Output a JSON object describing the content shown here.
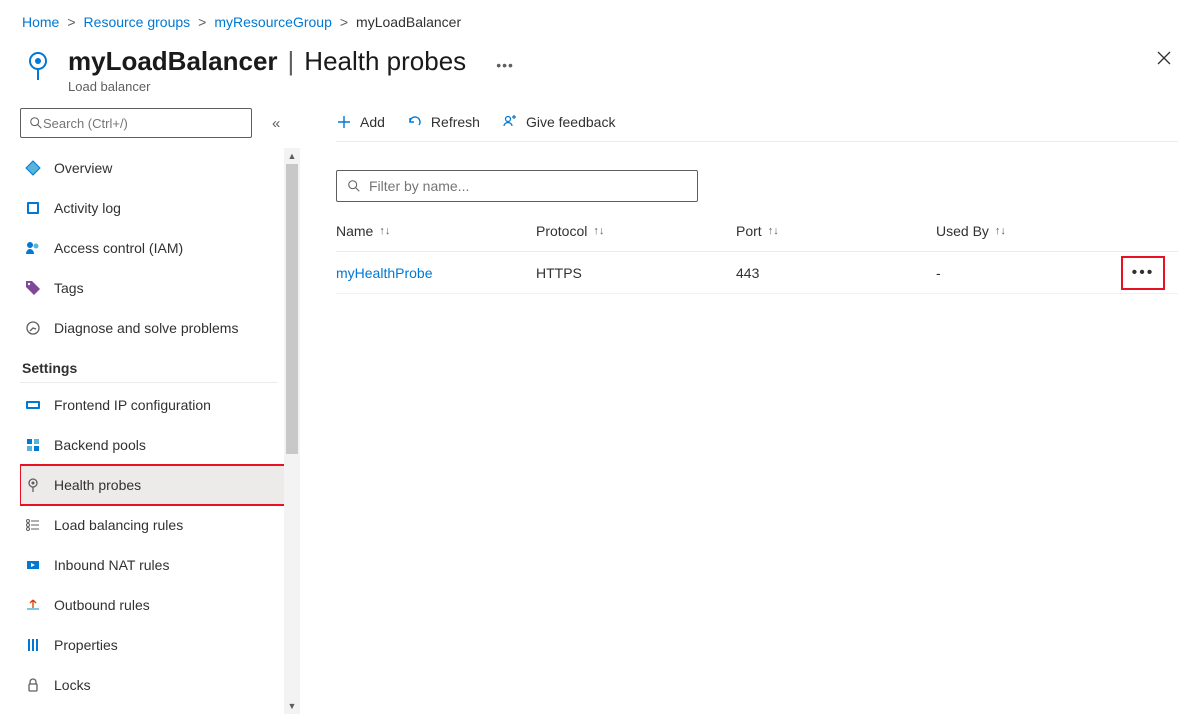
{
  "breadcrumb": [
    {
      "label": "Home",
      "link": true
    },
    {
      "label": "Resource groups",
      "link": true
    },
    {
      "label": "myResourceGroup",
      "link": true
    },
    {
      "label": "myLoadBalancer",
      "link": false
    }
  ],
  "header": {
    "title_main": "myLoadBalancer",
    "title_section": "Health probes",
    "subtitle": "Load balancer"
  },
  "sidebar": {
    "search_placeholder": "Search (Ctrl+/)",
    "top_items": [
      {
        "label": "Overview",
        "icon": "overview-icon"
      },
      {
        "label": "Activity log",
        "icon": "activity-log-icon"
      },
      {
        "label": "Access control (IAM)",
        "icon": "access-control-icon"
      },
      {
        "label": "Tags",
        "icon": "tags-icon"
      },
      {
        "label": "Diagnose and solve problems",
        "icon": "diagnose-icon"
      }
    ],
    "settings_label": "Settings",
    "settings_items": [
      {
        "label": "Frontend IP configuration",
        "icon": "frontend-ip-icon"
      },
      {
        "label": "Backend pools",
        "icon": "backend-pools-icon"
      },
      {
        "label": "Health probes",
        "icon": "health-probes-icon",
        "active": true,
        "highlight": true
      },
      {
        "label": "Load balancing rules",
        "icon": "lb-rules-icon"
      },
      {
        "label": "Inbound NAT rules",
        "icon": "inbound-nat-icon"
      },
      {
        "label": "Outbound rules",
        "icon": "outbound-rules-icon"
      },
      {
        "label": "Properties",
        "icon": "properties-icon"
      },
      {
        "label": "Locks",
        "icon": "locks-icon"
      }
    ]
  },
  "toolbar": {
    "add_label": "Add",
    "refresh_label": "Refresh",
    "feedback_label": "Give feedback"
  },
  "filter": {
    "placeholder": "Filter by name..."
  },
  "table": {
    "columns": [
      "Name",
      "Protocol",
      "Port",
      "Used By"
    ],
    "rows": [
      {
        "name": "myHealthProbe",
        "protocol": "HTTPS",
        "port": "443",
        "used_by": "-",
        "highlight_more": true
      }
    ]
  }
}
